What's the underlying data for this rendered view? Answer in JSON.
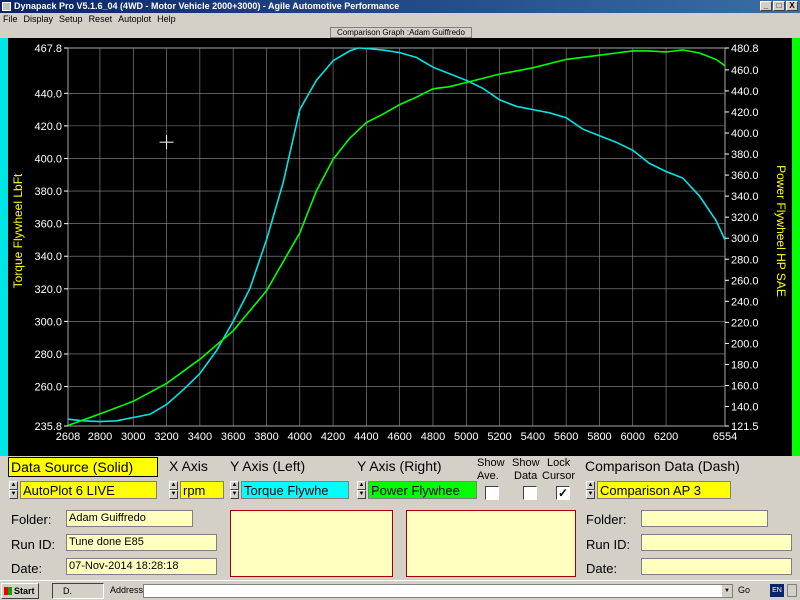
{
  "window": {
    "title": "Dynapack Pro V5.1.6_04 (4WD - Motor Vehicle 2000+3000) - Agile Automotive Performance",
    "buttons": [
      "_",
      "□",
      "X"
    ]
  },
  "menu": [
    "File",
    "Display",
    "Setup",
    "Reset",
    "Autoplot",
    "Help"
  ],
  "graph": {
    "title": "Comparison Graph :Adam Guiffredo",
    "left_axis_label": "Torque Flywheel LbFt",
    "right_axis_label": "Power Flywheel HP SAE",
    "left_color": "#00e5e5",
    "right_color": "#00ff00"
  },
  "chart_data": {
    "type": "line",
    "x_ticks": [
      "2608",
      "2800",
      "3000",
      "3200",
      "3400",
      "3600",
      "3800",
      "4000",
      "4200",
      "4400",
      "4600",
      "4800",
      "5000",
      "5200",
      "5400",
      "5600",
      "5800",
      "6000",
      "6200",
      "6554"
    ],
    "xlim": [
      2608,
      6554
    ],
    "left_ticks": [
      "467.8",
      "440.0",
      "420.0",
      "400.0",
      "380.0",
      "360.0",
      "340.0",
      "320.0",
      "300.0",
      "280.0",
      "260.0",
      "235.8"
    ],
    "left_ylim": [
      235.8,
      467.8
    ],
    "right_ticks": [
      "480.8",
      "460.0",
      "440.0",
      "420.0",
      "400.0",
      "380.0",
      "360.0",
      "340.0",
      "320.0",
      "300.0",
      "280.0",
      "260.0",
      "240.0",
      "220.0",
      "200.0",
      "180.0",
      "160.0",
      "140.0",
      "121.5"
    ],
    "right_ylim": [
      121.5,
      480.8
    ],
    "series": [
      {
        "name": "Torque Flywheel",
        "axis": "left",
        "color": "#00e5e5",
        "x": [
          2608,
          2700,
          2800,
          2900,
          3000,
          3100,
          3200,
          3300,
          3400,
          3500,
          3600,
          3700,
          3800,
          3900,
          4000,
          4100,
          4200,
          4300,
          4350,
          4400,
          4500,
          4600,
          4700,
          4800,
          4900,
          5000,
          5100,
          5200,
          5300,
          5400,
          5500,
          5600,
          5700,
          5800,
          5900,
          6000,
          6100,
          6200,
          6300,
          6400,
          6500,
          6554
        ],
        "y": [
          240.0,
          239.0,
          238.5,
          239.0,
          241.0,
          243.0,
          249.0,
          258.0,
          268.0,
          282.0,
          300.0,
          320.0,
          350.0,
          385.0,
          430.0,
          448.0,
          460.0,
          466.0,
          467.8,
          467.5,
          466.5,
          465.0,
          462.0,
          456.0,
          452.0,
          448.0,
          443.0,
          436.0,
          432.0,
          430.0,
          428.0,
          425.0,
          418.0,
          414.0,
          410.0,
          405.0,
          397.0,
          392.0,
          388.0,
          377.0,
          362.0,
          350.0
        ]
      },
      {
        "name": "Power Flywheel",
        "axis": "right",
        "color": "#00ff00",
        "x": [
          2608,
          2800,
          3000,
          3200,
          3400,
          3600,
          3800,
          4000,
          4100,
          4200,
          4300,
          4400,
          4500,
          4600,
          4700,
          4800,
          4900,
          5000,
          5200,
          5400,
          5600,
          5800,
          5900,
          6000,
          6100,
          6200,
          6300,
          6400,
          6500,
          6554
        ],
        "y": [
          122.0,
          133.0,
          145.0,
          162.0,
          185.0,
          212.0,
          250.0,
          305.0,
          345.0,
          375.0,
          395.0,
          410.0,
          418.0,
          427.0,
          434.0,
          442.0,
          444.0,
          448.0,
          456.0,
          462.0,
          470.0,
          474.0,
          476.0,
          478.0,
          478.0,
          477.0,
          479.0,
          476.0,
          470.0,
          464.0
        ]
      }
    ],
    "grid": true,
    "cursor_marker": {
      "x": 3200,
      "y": 410.0
    }
  },
  "controls": {
    "data_source_header": "Data Source (Solid)",
    "data_source_value": "AutoPlot 6 LIVE",
    "x_axis_header": "X Axis",
    "x_axis_value": "rpm",
    "y_left_header": "Y Axis (Left)",
    "y_left_value": "Torque Flywhe",
    "y_right_header": "Y Axis (Right)",
    "y_right_value": "Power Flywhee",
    "show_ave_label1": "Show",
    "show_ave_label2": "Ave.",
    "show_data_label1": "Show",
    "show_data_label2": "Data",
    "lock_cursor_label1": "Lock",
    "lock_cursor_label2": "Cursor",
    "show_ave_checked": false,
    "show_data_checked": false,
    "lock_cursor_checked": true,
    "lock_cursor_mark": "✓",
    "comparison_header": "Comparison Data (Dash)",
    "comparison_value": "Comparison AP 3"
  },
  "info_left": {
    "folder_label": "Folder:",
    "folder_value": "Adam Guiffredo",
    "runid_label": "Run ID:",
    "runid_value": "Tune done E85",
    "date_label": "Date:",
    "date_value": "07-Nov-2014  18:28:18"
  },
  "info_right": {
    "folder_label": "Folder:",
    "folder_value": "",
    "runid_label": "Run ID:",
    "runid_value": "",
    "date_label": "Date:",
    "date_value": ""
  },
  "taskbar": {
    "start_label": "Start",
    "task_label": "D.",
    "address_label": "Address",
    "go_label": "Go",
    "lang_label": "EN"
  }
}
